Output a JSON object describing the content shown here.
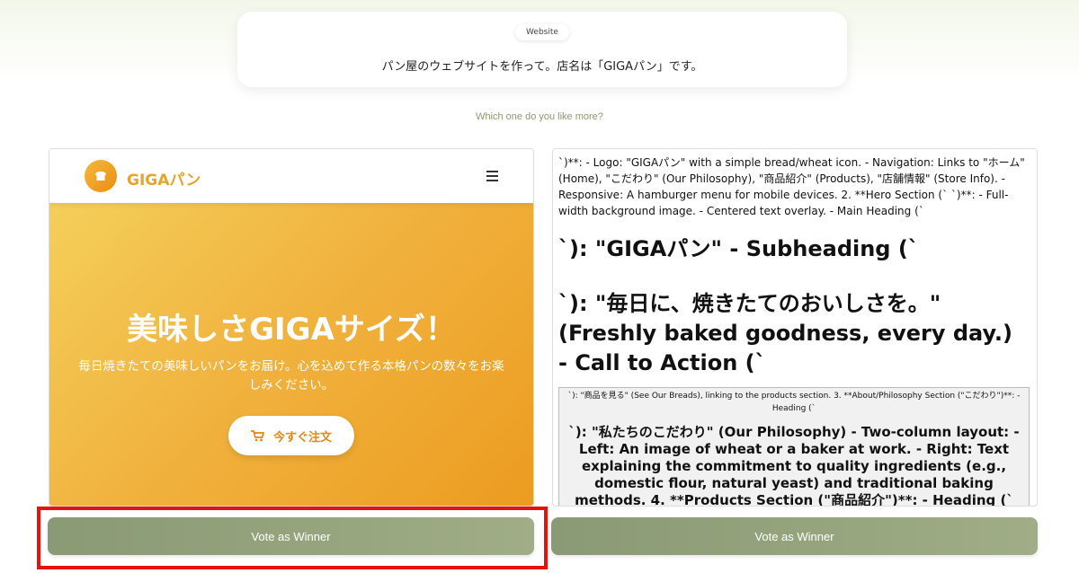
{
  "prompt": {
    "tag": "Website",
    "text": "パン屋のウェブサイトを作って。店名は「GIGAパン」です。"
  },
  "question": "Which one do you like more?",
  "left_site": {
    "logo_icon": "bread-icon",
    "brand": "GIGAパン",
    "menu_icon": "hamburger-menu-icon",
    "hero_title": "美味しさGIGAサイズ！",
    "hero_subtitle": "毎日焼きたての美味しいパンをお届け。心を込めて作る本格パンの数々をお楽しみください。",
    "order_button": "今すぐ注文",
    "order_icon": "cart-icon",
    "colors": {
      "brand": "#e8a32a",
      "hero_start": "#f4cf5a",
      "hero_end": "#ec9c20"
    }
  },
  "right_site": {
    "raw_text": "`)**: - Logo: \"GIGAパン\" with a simple bread/wheat icon. - Navigation: Links to \"ホーム\" (Home), \"こだわり\" (Our Philosophy), \"商品紹介\" (Products), \"店舗情報\" (Store Info). - Responsive: A hamburger menu for mobile devices. 2. **Hero Section (` `)**: - Full-width background image. - Centered text overlay. - Main Heading (`",
    "heading_1": "`): \"GIGAパン\" - Subheading (`",
    "heading_2": "`): \"毎日に、焼きたてのおいしさを。\" (Freshly baked goodness, every day.) - Call to Action (`",
    "inner_small": "`): \"商品を見る\" (See Our Breads), linking to the products section. 3. **About/Philosophy Section (\"こだわり\")**: - Heading (`",
    "inner_bold": "`): \"私たちのこだわり\" (Our Philosophy) - Two-column layout: - Left: An image of wheat or a baker at work. - Right: Text explaining the commitment to quality ingredients (e.g., domestic flour, natural yeast) and traditional baking methods. 4. **Products Section (\"商品紹介\")**: - Heading (`"
  },
  "vote": {
    "left_label": "Vote as Winner",
    "right_label": "Vote as Winner",
    "highlight_color": "#e8120c"
  }
}
